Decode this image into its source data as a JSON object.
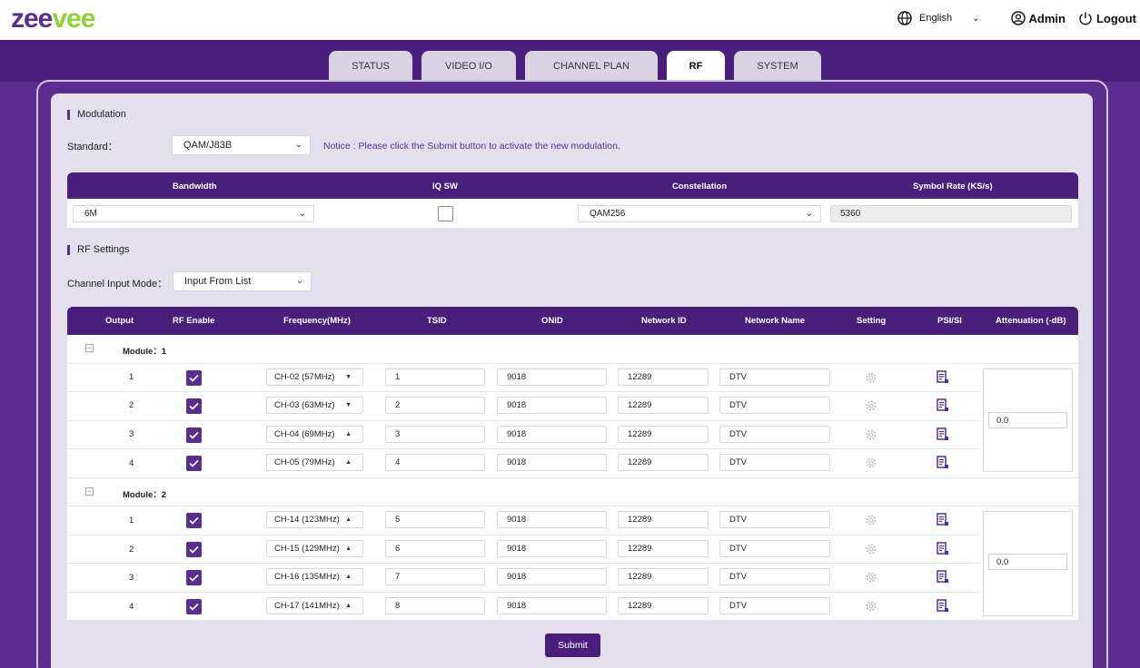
{
  "brand": {
    "logo_text_a": "zee",
    "logo_text_b": "vee"
  },
  "header": {
    "language": "English",
    "user": "Admin",
    "logout": "Logout"
  },
  "tabs": [
    {
      "label": "STATUS",
      "active": false
    },
    {
      "label": "VIDEO I/O",
      "active": false
    },
    {
      "label": "CHANNEL PLAN",
      "active": false
    },
    {
      "label": "RF",
      "active": true
    },
    {
      "label": "SYSTEM",
      "active": false
    }
  ],
  "modulation": {
    "title": "Modulation",
    "standard_label": "Standard：",
    "standard_value": "QAM/J83B",
    "notice": "Notice : Please click the Submit button to activate the new modulation.",
    "headers": {
      "bandwidth": "Bandwidth",
      "iqsw": "IQ SW",
      "constellation": "Constellation",
      "symbol_rate": "Symbol Rate (KS/s)"
    },
    "bandwidth": "6M",
    "iqsw_checked": false,
    "constellation": "QAM256",
    "symbol_rate": "5360"
  },
  "rf": {
    "title": "RF Settings",
    "mode_label": "Channel Input Mode：",
    "mode_value": "Input From List",
    "headers": {
      "output": "Output",
      "rf_enable": "RF Enable",
      "frequency": "Frequency(MHz)",
      "tsid": "TSID",
      "onid": "ONID",
      "network_id": "Network ID",
      "network_name": "Network Name",
      "setting": "Setting",
      "psisi": "PSI/SI",
      "attenuation": "Attenuation (-dB)"
    },
    "modules": [
      {
        "label": "Module：1",
        "attenuation": "0.0",
        "rows": [
          {
            "output": "1",
            "enabled": true,
            "channel": "CH-02 (57MHz)",
            "arrow": "▼",
            "tsid": "1",
            "onid": "9018",
            "network_id": "12289",
            "network_name": "DTV"
          },
          {
            "output": "2",
            "enabled": true,
            "channel": "CH-03 (63MHz)",
            "arrow": "▼",
            "tsid": "2",
            "onid": "9018",
            "network_id": "12289",
            "network_name": "DTV"
          },
          {
            "output": "3",
            "enabled": true,
            "channel": "CH-04 (69MHz)",
            "arrow": "▲",
            "tsid": "3",
            "onid": "9018",
            "network_id": "12289",
            "network_name": "DTV"
          },
          {
            "output": "4",
            "enabled": true,
            "channel": "CH-05 (79MHz)",
            "arrow": "▲",
            "tsid": "4",
            "onid": "9018",
            "network_id": "12289",
            "network_name": "DTV"
          }
        ]
      },
      {
        "label": "Module：2",
        "attenuation": "0.0",
        "rows": [
          {
            "output": "1",
            "enabled": true,
            "channel": "CH-14 (123MHz)",
            "arrow": "▲",
            "tsid": "5",
            "onid": "9018",
            "network_id": "12289",
            "network_name": "DTV"
          },
          {
            "output": "2",
            "enabled": true,
            "channel": "CH-15 (129MHz)",
            "arrow": "▲",
            "tsid": "6",
            "onid": "9018",
            "network_id": "12289",
            "network_name": "DTV"
          },
          {
            "output": "3",
            "enabled": true,
            "channel": "CH-16 (135MHz)",
            "arrow": "▲",
            "tsid": "7",
            "onid": "9018",
            "network_id": "12289",
            "network_name": "DTV"
          },
          {
            "output": "4",
            "enabled": true,
            "channel": "CH-17 (141MHz)",
            "arrow": "▲",
            "tsid": "8",
            "onid": "9018",
            "network_id": "12289",
            "network_name": "DTV"
          }
        ]
      }
    ]
  },
  "submit_label": "Submit",
  "colors": {
    "brand_purple": "#5b2d8e",
    "header_purple": "#4a1f7c",
    "logo_green": "#8fd13a"
  }
}
